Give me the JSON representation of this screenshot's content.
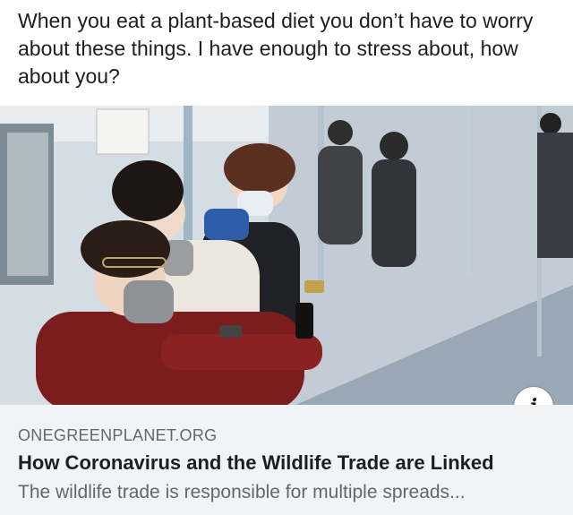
{
  "post": {
    "text": "When you eat a plant-based diet you don’t have to worry about these things. I have enough to stress about, how about you?"
  },
  "link_preview": {
    "domain": "ONEGREENPLANET.ORG",
    "headline": "How Coronavirus and the Wildlife Trade are Linked",
    "description": "The wildlife trade is responsible for multiple spreads..."
  },
  "info_button": {
    "icon": "info-icon",
    "glyph": "i"
  },
  "colors": {
    "card_background": "#f2f3f5",
    "secondary_text": "#606770",
    "primary_text": "#1c1e21"
  }
}
